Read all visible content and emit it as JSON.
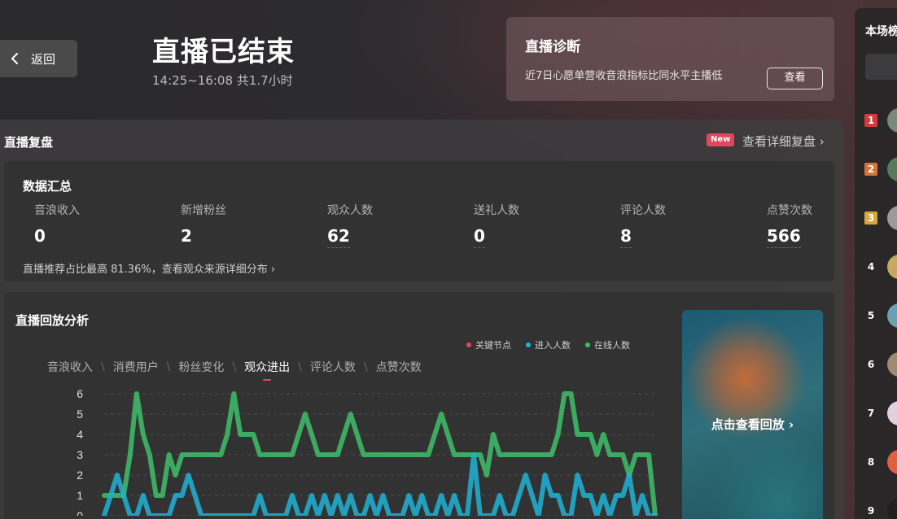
{
  "header": {
    "back_label": "返回",
    "title": "直播已结束",
    "subtitle": "14:25~16:08 共1.7小时"
  },
  "diagnosis": {
    "title": "直播诊断",
    "text": "近7日心愿单营收音浪指标比同水平主播低",
    "button_label": "查看"
  },
  "review": {
    "section_title": "直播复盘",
    "new_badge": "New",
    "detail_link": "查看详细复盘 ›"
  },
  "summary": {
    "title": "数据汇总",
    "metrics": [
      {
        "label": "音浪收入",
        "value": "0"
      },
      {
        "label": "新增粉丝",
        "value": "2"
      },
      {
        "label": "观众人数",
        "value": "62"
      },
      {
        "label": "送礼人数",
        "value": "0"
      },
      {
        "label": "评论人数",
        "value": "8"
      },
      {
        "label": "点赞次数",
        "value": "566"
      }
    ],
    "note": "直播推荐占比最高 81.36%，查看观众来源详细分布 ›"
  },
  "replay": {
    "title": "直播回放分析",
    "legend": [
      {
        "name": "关键节点",
        "color": "#e0465e"
      },
      {
        "name": "进入人数",
        "color": "#1fb3d6"
      },
      {
        "name": "在线人数",
        "color": "#3fbf6a"
      }
    ],
    "tabs": [
      "音浪收入",
      "消费用户",
      "粉丝变化",
      "观众进出",
      "评论人数",
      "点赞次数"
    ],
    "active_tab": "观众进出",
    "thumb_label": "点击查看回放 ›"
  },
  "chart_data": {
    "type": "line",
    "ylim": [
      0,
      6
    ],
    "yticks": [
      "6",
      "5",
      "4",
      "3",
      "2",
      "1",
      "0"
    ],
    "grid": true,
    "series": [
      {
        "name": "在线人数",
        "color": "#3fbf6a",
        "values": [
          1,
          1,
          1,
          1,
          3,
          6,
          4,
          3,
          1,
          1,
          3,
          2,
          3,
          3,
          3,
          3,
          3,
          3,
          3,
          4,
          6,
          4,
          4,
          4,
          3,
          3,
          3,
          3,
          3,
          3,
          4,
          5,
          4,
          3,
          3,
          3,
          3,
          4,
          5,
          4,
          3,
          3,
          3,
          3,
          3,
          3,
          3,
          3,
          3,
          3,
          3,
          4,
          5,
          4,
          3,
          3,
          3,
          3,
          3,
          2,
          4,
          3,
          3,
          3,
          3,
          3,
          3,
          3,
          3,
          3,
          4,
          6,
          6,
          4,
          4,
          4,
          3,
          4,
          3,
          3,
          3,
          2,
          3,
          3,
          3,
          0
        ]
      },
      {
        "name": "进入人数",
        "color": "#1fb3d6",
        "values": [
          0,
          1,
          2,
          1,
          0,
          0,
          1,
          0,
          0,
          0,
          0,
          1,
          1,
          2,
          1,
          0,
          0,
          0,
          0,
          0,
          0,
          0,
          0,
          0,
          1,
          0,
          0,
          0,
          0,
          1,
          0,
          0,
          1,
          0,
          1,
          0,
          1,
          0,
          1,
          0,
          0,
          1,
          0,
          1,
          0,
          0,
          0,
          1,
          0,
          1,
          0,
          0,
          1,
          0,
          1,
          0,
          0,
          3,
          0,
          0,
          0,
          1,
          0,
          0,
          1,
          2,
          1,
          0,
          2,
          1,
          1,
          0,
          0,
          2,
          1,
          1,
          0,
          1,
          0,
          1,
          1,
          2,
          0,
          1,
          0,
          0
        ]
      }
    ]
  },
  "ranking": {
    "title": "本场榜单",
    "items": [
      {
        "rank": "1",
        "badge_color": "#d23b3b",
        "avatar_color": "#7a8a7a"
      },
      {
        "rank": "2",
        "badge_color": "#d4743a",
        "avatar_color": "#5a7a5a"
      },
      {
        "rank": "3",
        "badge_color": "#d4a83a",
        "avatar_color": "#9a9a9a"
      },
      {
        "rank": "4",
        "badge_color": "",
        "avatar_color": "#c8a860"
      },
      {
        "rank": "5",
        "badge_color": "",
        "avatar_color": "#6aa0b0"
      },
      {
        "rank": "6",
        "badge_color": "",
        "avatar_color": "#a08a70"
      },
      {
        "rank": "7",
        "badge_color": "",
        "avatar_color": "#e0d0e0"
      },
      {
        "rank": "8",
        "badge_color": "",
        "avatar_color": "#e06040"
      },
      {
        "rank": "9",
        "badge_color": "",
        "avatar_color": "#202020"
      }
    ]
  }
}
